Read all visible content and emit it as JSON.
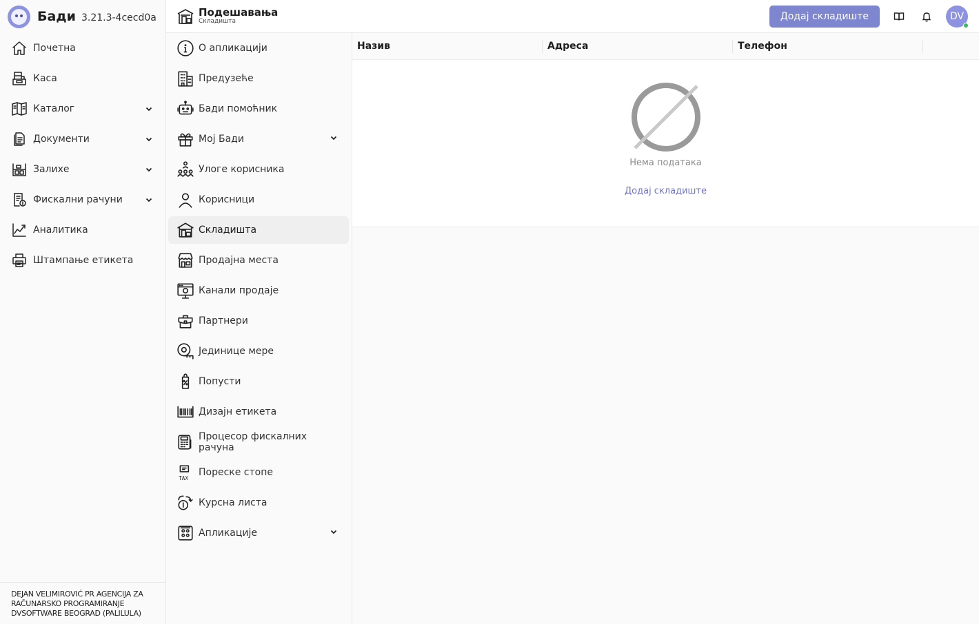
{
  "app": {
    "name": "Бади",
    "version": "3.21.3-4cecd0a"
  },
  "main_nav": [
    {
      "label": "Почетна",
      "icon": "home-icon",
      "has_children": false
    },
    {
      "label": "Каса",
      "icon": "cash-register-icon",
      "has_children": false
    },
    {
      "label": "Каталог",
      "icon": "catalog-book-icon",
      "has_children": true
    },
    {
      "label": "Документи",
      "icon": "documents-icon",
      "has_children": true
    },
    {
      "label": "Залихе",
      "icon": "inventory-icon",
      "has_children": true
    },
    {
      "label": "Фискални рачуни",
      "icon": "fiscal-receipt-icon",
      "has_children": true
    },
    {
      "label": "Аналитика",
      "icon": "analytics-chart-icon",
      "has_children": false
    },
    {
      "label": "Штампање етикета",
      "icon": "label-printer-icon",
      "has_children": false
    }
  ],
  "company": {
    "name": "DEJAN VELIMIROVIĆ PR AGENCIJA ZA RAČUNARSKO PROGRAMIRANJE DVSOFTWARE BEOGRAD (PALILULA)"
  },
  "header": {
    "title": "Подешавања",
    "subtitle": "Складишта",
    "add_button": "Додај складиште",
    "avatar_initials": "DV"
  },
  "settings_nav": [
    {
      "label": "О апликацији",
      "icon": "info-icon",
      "has_children": false,
      "active": false
    },
    {
      "label": "Предузеће",
      "icon": "company-building-icon",
      "has_children": false,
      "active": false
    },
    {
      "label": "Бади помоћник",
      "icon": "robot-assistant-icon",
      "has_children": false,
      "active": false
    },
    {
      "label": "Мој Бади",
      "icon": "gift-box-icon",
      "has_children": true,
      "active": false
    },
    {
      "label": "Улоге корисника",
      "icon": "user-roles-icon",
      "has_children": false,
      "active": false
    },
    {
      "label": "Корисници",
      "icon": "user-icon",
      "has_children": false,
      "active": false
    },
    {
      "label": "Складишта",
      "icon": "warehouse-icon",
      "has_children": false,
      "active": true
    },
    {
      "label": "Продајна места",
      "icon": "store-icon",
      "has_children": false,
      "active": false
    },
    {
      "label": "Канали продаје",
      "icon": "sales-channel-icon",
      "has_children": false,
      "active": false
    },
    {
      "label": "Партнери",
      "icon": "partners-briefcase-icon",
      "has_children": false,
      "active": false
    },
    {
      "label": "Јединице мере",
      "icon": "measure-tape-icon",
      "has_children": false,
      "active": false
    },
    {
      "label": "Попусти",
      "icon": "discount-tag-icon",
      "has_children": false,
      "active": false
    },
    {
      "label": "Дизајн етикета",
      "icon": "barcode-icon",
      "has_children": false,
      "active": false
    },
    {
      "label": "Процесор фискалних рачуна",
      "icon": "fiscal-processor-icon",
      "has_children": false,
      "active": false
    },
    {
      "label": "Пореске стопе",
      "icon": "tax-icon",
      "has_children": false,
      "active": false
    },
    {
      "label": "Курсна листа",
      "icon": "exchange-rate-icon",
      "has_children": false,
      "active": false
    },
    {
      "label": "Апликације",
      "icon": "apps-grid-icon",
      "has_children": true,
      "active": false
    }
  ],
  "table": {
    "columns": [
      "Назив",
      "Адреса",
      "Телефон",
      ""
    ],
    "empty_text": "Нема података",
    "empty_action": "Додај складиште"
  },
  "colors": {
    "accent": "#7e86cf",
    "link": "#6d74c4",
    "online": "#2fbf5a"
  }
}
